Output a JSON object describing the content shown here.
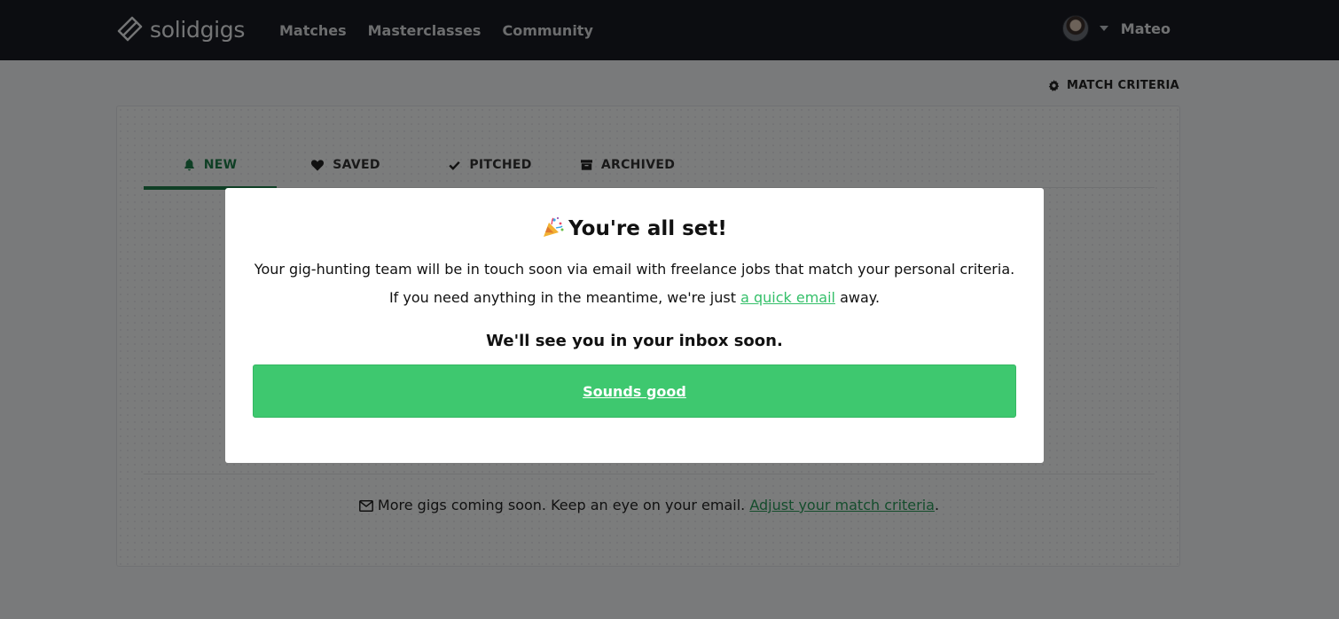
{
  "nav": {
    "brand": "solidgigs",
    "links": [
      "Matches",
      "Masterclasses",
      "Community"
    ],
    "user_name": "Mateo"
  },
  "page": {
    "criteria_link": "MATCH CRITERIA",
    "tabs": [
      {
        "label": "NEW",
        "icon": "bell-icon",
        "active": true
      },
      {
        "label": "SAVED",
        "icon": "heart-icon",
        "active": false
      },
      {
        "label": "PITCHED",
        "icon": "check-icon",
        "active": false
      },
      {
        "label": "ARCHIVED",
        "icon": "archive-icon",
        "active": false
      }
    ],
    "footer": {
      "text": "More gigs coming soon. Keep an eye on your email.",
      "link": "Adjust your match criteria",
      "end": "."
    }
  },
  "modal": {
    "title": "You're all set!",
    "paragraph1": "Your gig-hunting team will be in touch soon via email with freelance jobs that match your personal criteria.",
    "paragraph2_before": "If you need anything in the meantime, we're just",
    "paragraph2_link": "a quick email",
    "paragraph2_after": "away.",
    "subtitle": "We'll see you in your inbox soon.",
    "button": "Sounds good"
  },
  "colors": {
    "nav_bg": "#181b22",
    "accent_green": "#3ec86f",
    "tab_active": "#1e7f4a"
  }
}
